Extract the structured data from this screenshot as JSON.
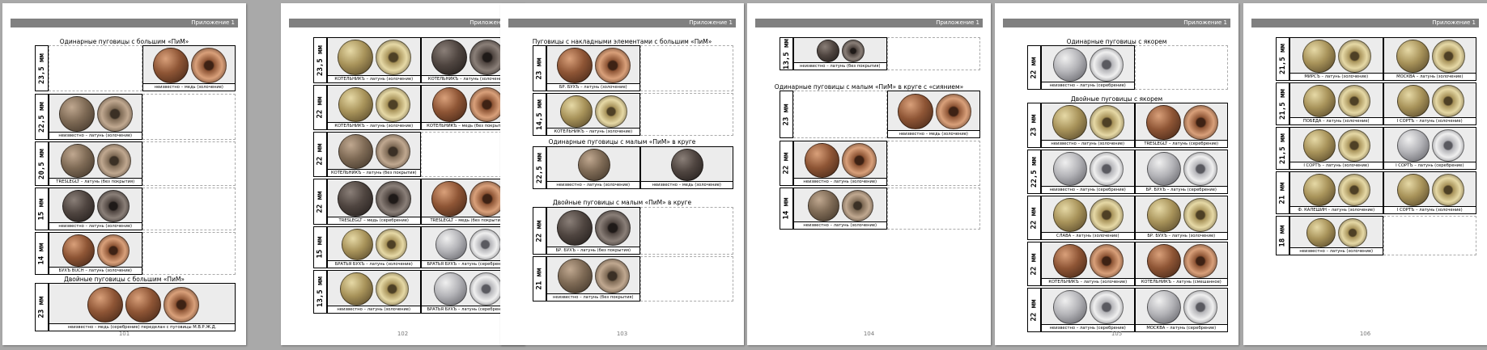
{
  "header_label": "Приложение 1",
  "colors": {
    "brass": {
      "hl": "#e6d9a6",
      "mid": "#a8935a",
      "dk": "#4e4025"
    },
    "copper": {
      "hl": "#d9a07a",
      "mid": "#8e5535",
      "dk": "#3e2214"
    },
    "silver": {
      "hl": "#f0f0f0",
      "mid": "#b4b4b8",
      "dk": "#5a5a60"
    },
    "dark": {
      "hl": "#8a7f78",
      "mid": "#4f4540",
      "dk": "#1f1a18"
    },
    "tarnish": {
      "hl": "#c0a890",
      "mid": "#7e6a55",
      "dk": "#3b3025"
    }
  },
  "pages": [
    {
      "number": "101",
      "sections": [
        {
          "title": "Одинарные пуговицы с большим «ПиМ»"
        },
        {
          "title": "Двойные пуговицы с большим «ПиМ»"
        }
      ],
      "rows": [
        {
          "size": "23,5 мм",
          "cells": [
            null,
            {
              "caption": "неизвестно – медь (золочение)",
              "tone": "copper",
              "count": 2
            }
          ]
        },
        {
          "size": "22,5 мм",
          "cells": [
            {
              "caption": "неизвестно – латунь (золочение)",
              "tone": "tarnish",
              "count": 2
            },
            null
          ]
        },
        {
          "size": "20,5 мм",
          "cells": [
            {
              "caption": "TRESLEGLT – латунь (без покрытия)",
              "tone": "tarnish",
              "count": 2
            },
            null
          ]
        },
        {
          "size": "15 мм",
          "cells": [
            {
              "caption": "неизвестно – латунь (золочение)",
              "tone": "dark",
              "count": 2
            },
            null
          ]
        },
        {
          "size": "14 мм",
          "cells": [
            {
              "caption": "БУХЪ BUCH – латунь (золочение)",
              "tone": "copper",
              "count": 2
            },
            null
          ]
        },
        {
          "size": "23 мм",
          "cells": [
            {
              "caption": "неизвестно – медь (серебрение) переделан с пуговицы М.В.Р.Ж.Д.",
              "tone": "copper",
              "count": 3
            }
          ]
        }
      ]
    },
    {
      "number": "102",
      "sections": [],
      "rows": [
        {
          "size": "23,5 мм",
          "cells": [
            {
              "caption": "КОТЕЛЬНИКЪ – латунь (золочение)",
              "tone": "brass",
              "count": 2
            },
            {
              "caption": "КОТЕЛЬНИКЪ – латунь (золочение)",
              "tone": "dark",
              "count": 2
            }
          ]
        },
        {
          "size": "22 мм",
          "cells": [
            {
              "caption": "КОТЕЛЬНИКЪ – латунь (золочение)",
              "tone": "brass",
              "count": 2
            },
            {
              "caption": "КОТЕЛЬНИКЪ – медь (без покрытия)",
              "tone": "copper",
              "count": 2
            }
          ]
        },
        {
          "size": "22 мм",
          "cells": [
            {
              "caption": "КОТЕЛЬНИКЪ – латунь (без покрытия)",
              "tone": "tarnish",
              "count": 2
            },
            null
          ]
        },
        {
          "size": "22 мм",
          "cells": [
            {
              "caption": "TRESLEGLT – медь (серебрение)",
              "tone": "dark",
              "count": 2
            },
            {
              "caption": "TRESLEGLT – медь (без покрытия)",
              "tone": "copper",
              "count": 2
            }
          ]
        },
        {
          "size": "15 мм",
          "cells": [
            {
              "caption": "БРАТЬЯ БУХЪ – латунь (золочение)",
              "tone": "brass",
              "count": 2
            },
            {
              "caption": "БРАТЬЯ БУХЪ – латунь (серебрение)",
              "tone": "silver",
              "count": 2
            }
          ]
        },
        {
          "size": "13,5 мм",
          "cells": [
            {
              "caption": "неизвестно – латунь (золочение)",
              "tone": "brass",
              "count": 2
            },
            {
              "caption": "БРАТЬЯ БУХЪ – латунь (серебрение)",
              "tone": "silver",
              "count": 2
            }
          ]
        }
      ]
    },
    {
      "number": "103",
      "sections": [
        {
          "title": "Пуговицы с накладными элементами с большим «ПиМ»"
        },
        {
          "title": "Одинарные пуговицы с малым «ПиМ» в круге"
        },
        {
          "title": "Двойные пуговицы с малым «ПиМ» в круге"
        }
      ],
      "rows": [
        {
          "size": "23 мм",
          "cells": [
            {
              "caption": "БР. БУХЪ – латунь (золочение)",
              "tone": "copper",
              "count": 2
            },
            null
          ]
        },
        {
          "size": "14,5 мм",
          "cells": [
            {
              "caption": "КОТЕЛЬНИКЪ – латунь (золочение)",
              "tone": "brass",
              "count": 2
            },
            null
          ]
        },
        {
          "size": "22,5 мм",
          "cells": [
            {
              "caption": "неизвестно – латунь (золочение)",
              "tone": "tarnish",
              "count": 1
            },
            {
              "caption": "неизвестно – медь (золочение)",
              "tone": "dark",
              "count": 1
            }
          ]
        },
        {
          "size": "22 мм",
          "cells": [
            {
              "caption": "БР. БУХЪ – латунь (без покрытия)",
              "tone": "dark",
              "count": 2
            },
            null
          ]
        },
        {
          "size": "21 мм",
          "cells": [
            {
              "caption": "неизвестно – латунь (без покрытия)",
              "tone": "tarnish",
              "count": 2
            },
            null
          ]
        }
      ]
    },
    {
      "number": "104",
      "sections": [
        {
          "title": "Одинарные пуговицы с малым «ПиМ» в круге с «сиянием»"
        }
      ],
      "rows": [
        {
          "size": "13,5 мм",
          "cells": [
            {
              "caption": "неизвестно – латунь (без покрытия)",
              "tone": "dark",
              "count": 2
            },
            null
          ]
        },
        {
          "size": "23 мм",
          "cells": [
            null,
            {
              "caption": "неизвестно – медь (золочение)",
              "tone": "copper",
              "count": 2
            }
          ]
        },
        {
          "size": "22 мм",
          "cells": [
            {
              "caption": "неизвестно – латунь (золочение)",
              "tone": "copper",
              "count": 2
            },
            null
          ]
        },
        {
          "size": "14 мм",
          "cells": [
            {
              "caption": "неизвестно – латунь (золочение)",
              "tone": "tarnish",
              "count": 2
            },
            null
          ]
        }
      ]
    },
    {
      "number": "105",
      "sections": [
        {
          "title": "Одинарные пуговицы с якорем"
        },
        {
          "title": "Двойные пуговицы с якорем"
        }
      ],
      "rows": [
        {
          "size": "22 мм",
          "cells": [
            {
              "caption": "неизвестно – латунь (серебрение)",
              "tone": "silver",
              "count": 2
            },
            null
          ]
        },
        {
          "size": "23 мм",
          "cells": [
            {
              "caption": "неизвестно – латунь (золочение)",
              "tone": "brass",
              "count": 2
            },
            {
              "caption": "TRESLEGLT – латунь (серебрение)",
              "tone": "copper",
              "count": 2
            }
          ]
        },
        {
          "size": "22,5 мм",
          "cells": [
            {
              "caption": "неизвестно – латунь (серебрение)",
              "tone": "silver",
              "count": 2
            },
            {
              "caption": "БР. БУХЪ – латунь (серебрение)",
              "tone": "silver",
              "count": 2
            }
          ]
        },
        {
          "size": "22 мм",
          "cells": [
            {
              "caption": "СЛАВА – латунь (золочение)",
              "tone": "brass",
              "count": 2
            },
            {
              "caption": "БР. БУХЪ – латунь (золочение)",
              "tone": "brass",
              "count": 2
            }
          ]
        },
        {
          "size": "22 мм",
          "cells": [
            {
              "caption": "КОТЕЛЬНИКЪ – латунь (золочение)",
              "tone": "copper",
              "count": 2
            },
            {
              "caption": "КОТЕЛЬНИКЪ – латунь (смешанное)",
              "tone": "copper",
              "count": 2
            }
          ]
        },
        {
          "size": "22 мм",
          "cells": [
            {
              "caption": "неизвестно – латунь (серебрение)",
              "tone": "silver",
              "count": 2
            },
            {
              "caption": "МОСКВА – латунь (серебрение)",
              "tone": "silver",
              "count": 2
            }
          ]
        }
      ]
    },
    {
      "number": "106",
      "sections": [],
      "rows": [
        {
          "size": "21,5 мм",
          "cells": [
            {
              "caption": "МИРСЪ – латунь (золочение)",
              "tone": "brass",
              "count": 2
            },
            {
              "caption": "МОСКВА – латунь (золочение)",
              "tone": "brass",
              "count": 2
            }
          ]
        },
        {
          "size": "21,5 мм",
          "cells": [
            {
              "caption": "ПОБЕДА – латунь (золочение)",
              "tone": "brass",
              "count": 2
            },
            {
              "caption": "I СОРТЪ – латунь (золочение)",
              "tone": "brass",
              "count": 2
            }
          ]
        },
        {
          "size": "21,5 мм",
          "cells": [
            {
              "caption": "I СОРТЪ – латунь (золочение)",
              "tone": "brass",
              "count": 2
            },
            {
              "caption": "I СОРТЪ – латунь (серебрение)",
              "tone": "silver",
              "count": 2
            }
          ]
        },
        {
          "size": "21 мм",
          "cells": [
            {
              "caption": "Ф. КАЛЕШИН – латунь (золочение)",
              "tone": "brass",
              "count": 2
            },
            {
              "caption": "I СОРТЪ – латунь (золочение)",
              "tone": "brass",
              "count": 2
            }
          ]
        },
        {
          "size": "18 мм",
          "cells": [
            {
              "caption": "неизвестно – латунь (золочение)",
              "tone": "brass",
              "count": 2
            },
            null
          ]
        }
      ]
    }
  ]
}
